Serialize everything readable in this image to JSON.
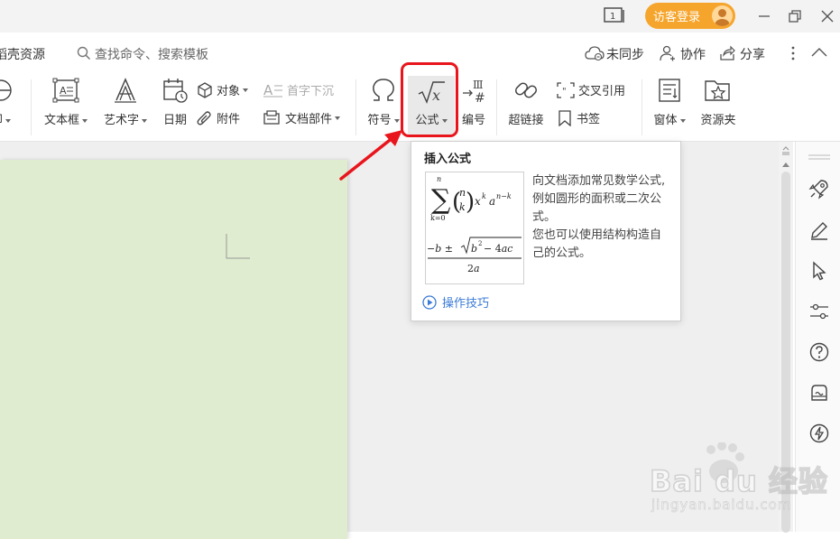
{
  "titlebar": {
    "page_badge": "1",
    "login_label": "访客登录"
  },
  "menubar": {
    "left_item": "稻壳资源",
    "search_placeholder": "查找命令、搜索模板",
    "sync_label": "未同步",
    "collab_label": "协作",
    "share_label": "分享"
  },
  "ribbon": {
    "print_label": "印",
    "textbox_label": "文本框",
    "wordart_label": "艺术字",
    "date_label": "日期",
    "object_label": "对象",
    "attach_label": "附件",
    "dropcap_label": "首字下沉",
    "docpart_label": "文档部件",
    "symbol_label": "符号",
    "formula_label": "公式",
    "numbering_label": "编号",
    "hyperlink_label": "超链接",
    "crossref_label": "交叉引用",
    "bookmark_label": "书签",
    "window_label": "窗体",
    "resource_label": "资源夹"
  },
  "tooltip": {
    "title": "插入公式",
    "description_line1": "向文档添加常见数学公式, 例如圆形的面积或二次公式。",
    "description_line2": "您也可以使用结构构造自己的公式。",
    "tips_link": "操作技巧"
  },
  "watermark": {
    "brand": "Bai du 经验",
    "url": "jingyan.baidu.com"
  },
  "colors": {
    "accent_orange": "#f6a52c",
    "highlight_red": "#e8161c",
    "link_blue": "#3c7bd6",
    "page_green": "#dfeccf"
  }
}
